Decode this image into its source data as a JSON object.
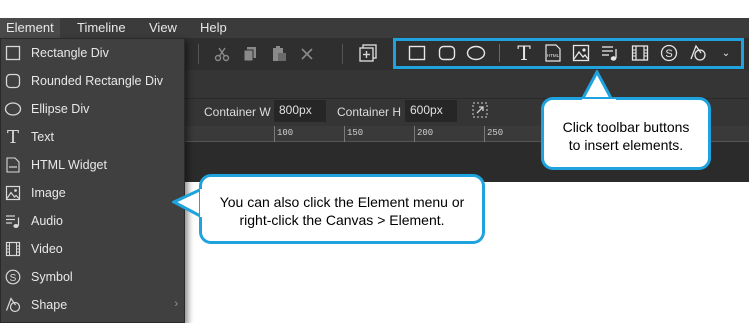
{
  "menubar": {
    "items": [
      {
        "label": "Element"
      },
      {
        "label": "Timeline"
      },
      {
        "label": "View"
      },
      {
        "label": "Help"
      }
    ]
  },
  "properties": {
    "container_w_label": "Container W",
    "container_w_value": "800px",
    "container_h_label": "Container H",
    "container_h_value": "600px"
  },
  "ruler": {
    "labels": [
      "100",
      "150",
      "200",
      "250"
    ]
  },
  "element_menu": {
    "items": [
      {
        "label": "Rectangle Div",
        "icon": "rectangle-icon"
      },
      {
        "label": "Rounded Rectangle Div",
        "icon": "rounded-rectangle-icon"
      },
      {
        "label": "Ellipse Div",
        "icon": "ellipse-icon"
      },
      {
        "label": "Text",
        "icon": "text-icon"
      },
      {
        "label": "HTML Widget",
        "icon": "html-widget-icon"
      },
      {
        "label": "Image",
        "icon": "image-icon"
      },
      {
        "label": "Audio",
        "icon": "audio-icon"
      },
      {
        "label": "Video",
        "icon": "video-icon"
      },
      {
        "label": "Symbol",
        "icon": "symbol-icon"
      },
      {
        "label": "Shape",
        "icon": "shape-icon",
        "has_submenu": true
      }
    ]
  },
  "toolbar": {
    "html_icon_text": "HTML",
    "symbol_icon_text": "S"
  },
  "callouts": {
    "toolbar_line1": "Click toolbar buttons",
    "toolbar_line2": "to insert elements.",
    "menu_line1": "You can also click the Element menu or",
    "menu_line2": "right-click the Canvas > Element."
  },
  "colors": {
    "accent": "#1fa3de",
    "panel_dark": "#2f2f2f",
    "menu_bg": "#404040"
  }
}
